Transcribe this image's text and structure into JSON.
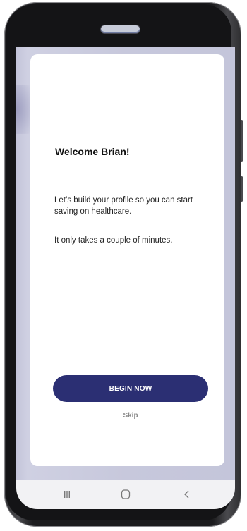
{
  "onboarding": {
    "title": "Welcome Brian!",
    "intro": "Let’s build your profile so you can start saving on healthcare.",
    "note": "It only takes a couple of minutes.",
    "begin_label": "BEGIN NOW",
    "skip_label": "Skip"
  },
  "nav_bar": {
    "recents_icon": "recents-icon",
    "home_icon": "home-icon",
    "back_icon": "back-icon"
  },
  "colors": {
    "accent": "#2b2f73",
    "screen_background": "#c7c8dc",
    "card_background": "#ffffff",
    "skip_text": "#8a8a8a",
    "nav_bar": "#f2f2f4"
  }
}
